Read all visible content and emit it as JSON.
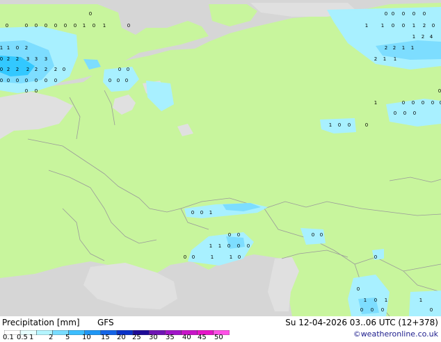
{
  "map": {
    "colors": {
      "land": "#c8f59d",
      "sea_ice": "#e0e0e0",
      "outside": "#d6d6d6",
      "border": "#9a9a9a",
      "precip_light": "#a8f0ff",
      "precip_mid": "#7dddff",
      "precip_heavy": "#32c8ff"
    },
    "values": [
      "0",
      "0",
      "0",
      "0",
      "0",
      "0",
      "0",
      "0",
      "0",
      "0",
      "0",
      "0",
      "0",
      "1",
      "0",
      "1",
      "0",
      "1",
      "1",
      "0",
      "0",
      "1",
      "2",
      "0",
      "1",
      "2",
      "4",
      "1",
      "1",
      "0",
      "2",
      "2",
      "2",
      "1",
      "1",
      "0",
      "2",
      "2",
      "3",
      "3",
      "3",
      "2",
      "1",
      "1",
      "0",
      "2",
      "2",
      "2",
      "2",
      "2",
      "2",
      "0",
      "0",
      "0",
      "0",
      "0",
      "0",
      "0",
      "0",
      "0",
      "0",
      "0",
      "0",
      "0",
      "0",
      "0",
      "0",
      "1",
      "0",
      "0",
      "0",
      "0",
      "0",
      "0",
      "0",
      "0",
      "1",
      "0",
      "0",
      "0",
      "0",
      "0",
      "1",
      "0",
      "0",
      "0",
      "0",
      "1",
      "1",
      "0",
      "0",
      "0",
      "0",
      "0",
      "1",
      "1",
      "0",
      "0",
      "0",
      "1",
      "0",
      "1",
      "1",
      "0",
      "0",
      "0",
      "0",
      "1",
      "1"
    ]
  },
  "footer": {
    "title": "Precipitation [mm]",
    "model": "GFS",
    "datetime": "Su 12-04-2026 03..06 UTC (12+378)",
    "credit": "©weatheronline.co.uk",
    "scale_labels": [
      "0.1",
      "0.5",
      "1",
      "2",
      "5",
      "10",
      "15",
      "20",
      "25",
      "30",
      "35",
      "40",
      "45",
      "50"
    ],
    "scale_colors": [
      "#ffffff",
      "#e6ffff",
      "#b4f5ff",
      "#78dcff",
      "#3cbeff",
      "#1e96f5",
      "#1464e6",
      "#0a32c8",
      "#1e0a96",
      "#6e14b4",
      "#a014c8",
      "#c814c8",
      "#e614c8",
      "#ff50e6"
    ]
  }
}
